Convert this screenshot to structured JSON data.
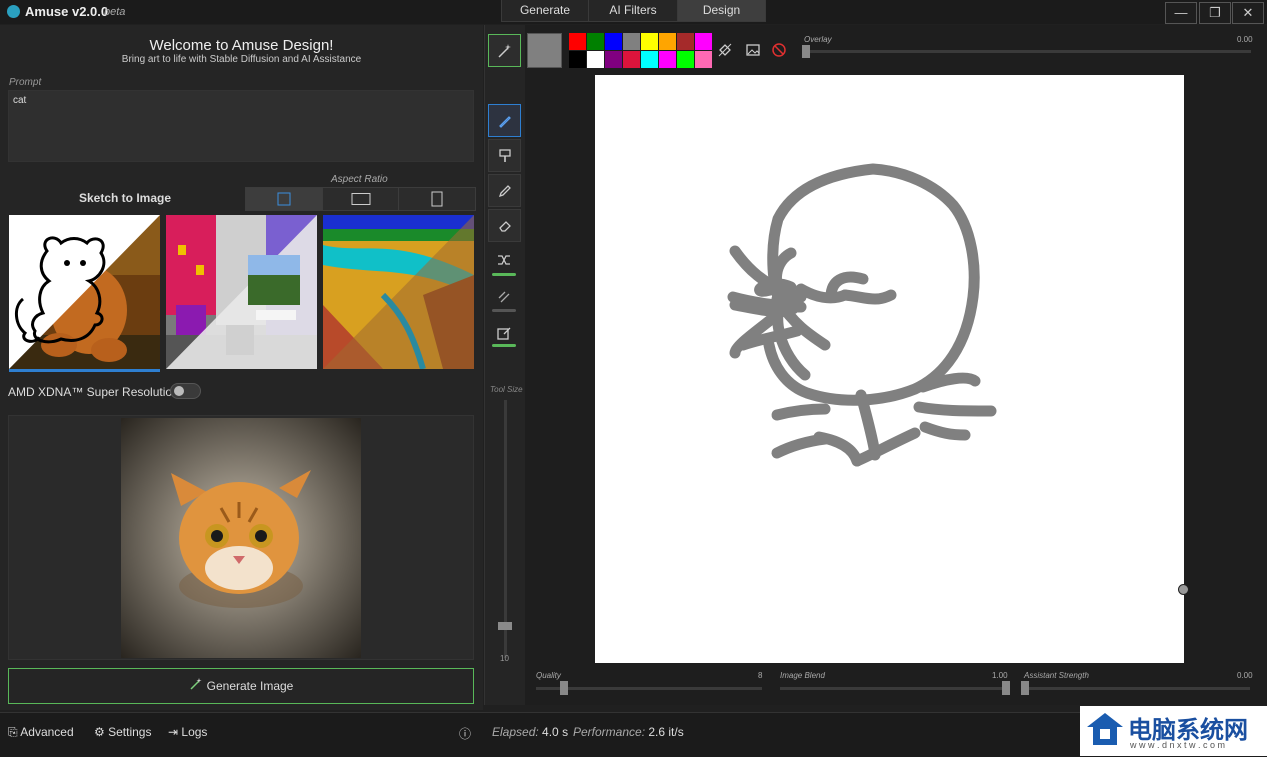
{
  "app": {
    "title": "Amuse v2.0.0",
    "badge": "beta"
  },
  "tabs": [
    {
      "label": "Generate"
    },
    {
      "label": "AI Filters"
    },
    {
      "label": "Design"
    }
  ],
  "window": {
    "minimize": "—",
    "restore": "❐",
    "close": "✕"
  },
  "welcome": {
    "title": "Welcome to Amuse Design!",
    "subtitle": "Bring art to life with Stable Diffusion and AI Assistance"
  },
  "prompt": {
    "label": "Prompt",
    "value": "cat"
  },
  "mode": {
    "label": "Sketch to Image"
  },
  "aspect_ratio": {
    "label": "Aspect Ratio",
    "options": [
      "square",
      "landscape",
      "portrait"
    ],
    "selected": "square"
  },
  "presets": [
    {
      "name": "teddy-bear-sketch"
    },
    {
      "name": "room-interior"
    },
    {
      "name": "canyon-landscape"
    }
  ],
  "super_resolution": {
    "label": "AMD XDNA™ Super Resolution",
    "enabled": false
  },
  "output": {
    "description": "generated image of a tabby cat"
  },
  "generate": {
    "label": "Generate Image"
  },
  "tools": {
    "size_label": "Tool Size",
    "size_value": "10"
  },
  "canvas": {
    "current_color": "#808080",
    "palette": [
      "#ff0000",
      "#008000",
      "#0000ff",
      "#808080",
      "#ffff00",
      "#ffa500",
      "#a52a2a",
      "#ff00ff",
      "#000000",
      "#ffffff",
      "#800080",
      "#dc143c",
      "#00ffff",
      "#ff00ff",
      "#00ff00",
      "#ff69b4"
    ],
    "overlay": {
      "label": "Overlay",
      "value": "0.00"
    },
    "quality": {
      "label": "Quality",
      "value": "8"
    },
    "image_blend": {
      "label": "Image Blend",
      "value": "1.00"
    },
    "assistant_strength": {
      "label": "Assistant Strength",
      "value": "0.00"
    }
  },
  "status": {
    "advanced": "Advanced",
    "settings": "Settings",
    "logs": "Logs",
    "elapsed_label": "Elapsed:",
    "elapsed_value": "4.0 s",
    "performance_label": "Performance:",
    "performance_value": "2.6 it/s"
  },
  "watermark": {
    "title": "电脑系统网",
    "url": "w w w . d n x t w . c o m"
  }
}
